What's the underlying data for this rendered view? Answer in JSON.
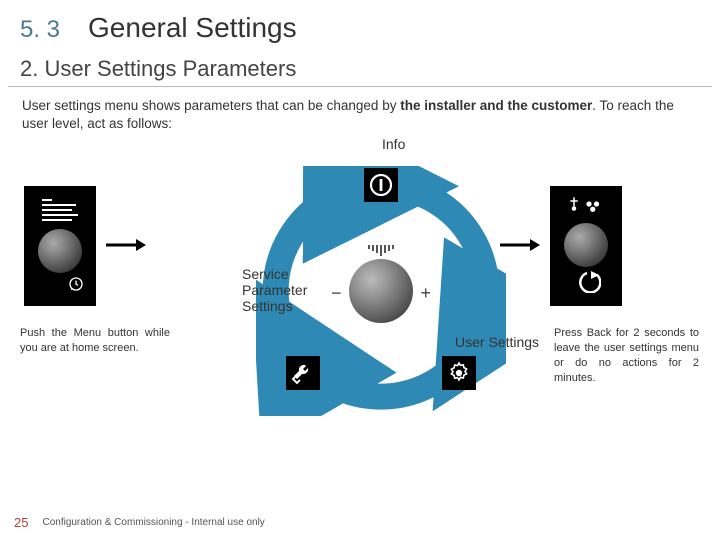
{
  "header": {
    "section_num": "5. 3",
    "section_title": "General Settings"
  },
  "sub_header": "2. User Settings Parameters",
  "intro": {
    "pre": "User settings menu shows parameters that can be changed by",
    "bold1": "the installer and the customer",
    "post": ". To reach the user level, act as follows:"
  },
  "labels": {
    "info": "Info",
    "service_l1": "Service",
    "service_l2": "Parameter",
    "service_l3": "Settings",
    "user": "User Settings",
    "minus": "−",
    "plus": "+"
  },
  "captions": {
    "left": "Push the Menu button while you are at home screen.",
    "right": "Press Back for 2 seconds to leave the user settings menu or do no actions for 2 minutes."
  },
  "footer": {
    "page": "25",
    "text": "Configuration & Commissioning - Internal use only"
  },
  "colors": {
    "ring": "#2f89b5"
  }
}
